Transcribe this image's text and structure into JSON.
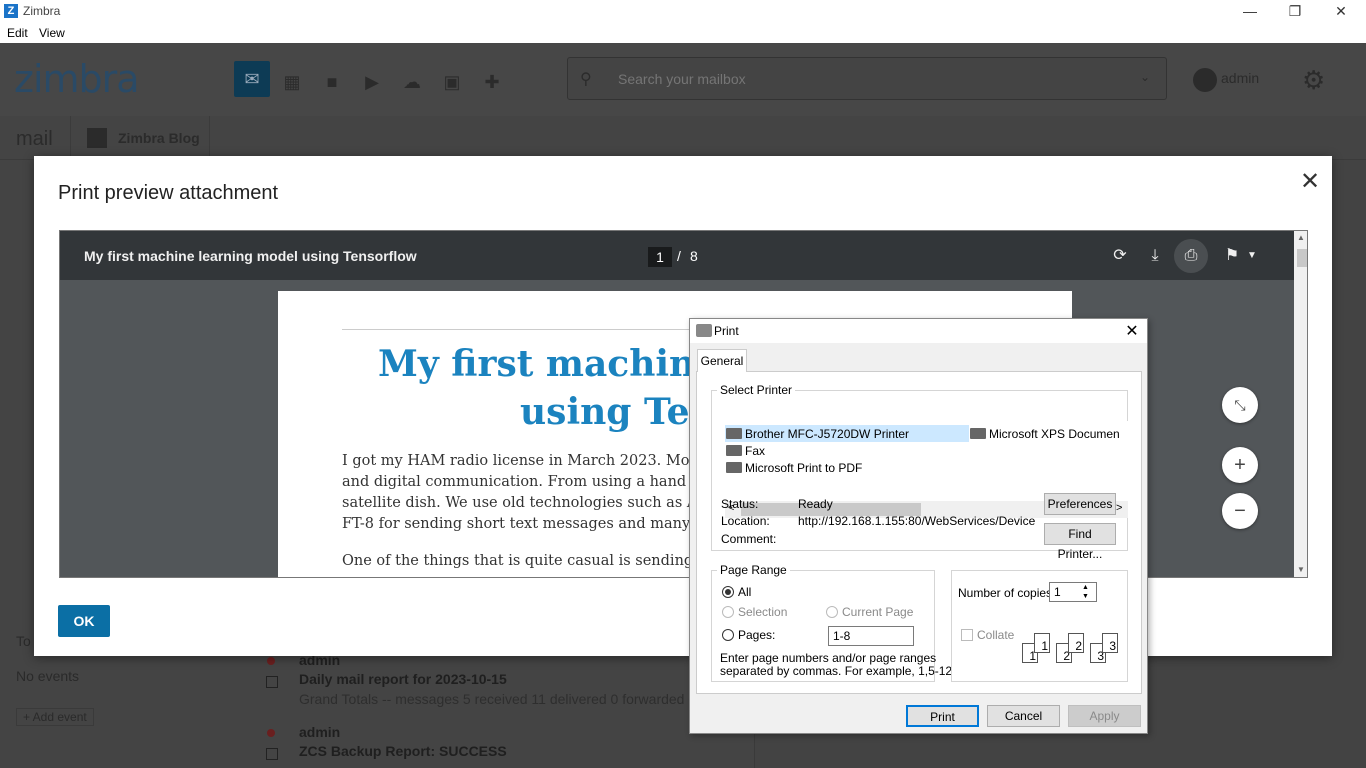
{
  "window": {
    "title": "Zimbra",
    "menu": [
      "Edit",
      "View"
    ],
    "controls": {
      "minimize": "—",
      "restore": "❐",
      "close": "✕"
    }
  },
  "app": {
    "logo": "zimbra",
    "search_placeholder": "Search your mailbox",
    "user": "admin",
    "tab_mail": "mail",
    "tab_blog": "Zimbra Blog",
    "calendar": {
      "partial": "To",
      "no_events": "No events",
      "add_event": "+ Add event"
    },
    "messages": [
      {
        "from": "admin",
        "subject": "Daily mail report for 2023-10-15",
        "snippet": "Grand Totals -- messages 5 received 11 delivered 0 forwarded 0"
      },
      {
        "from": "admin",
        "subject": "ZCS Backup Report: SUCCESS",
        "snippet": ""
      }
    ]
  },
  "modal": {
    "title": "Print preview attachment",
    "ok_label": "OK",
    "viewer": {
      "doc_title": "My first machine learning model using Tensorflow",
      "page_current": "1",
      "page_sep": "/",
      "page_total": "8",
      "pdf_heading_1": "My first machine",
      "pdf_heading_2": "using Ten",
      "pdf_lines": [
        "I got my HAM radio license in March 2023. Modern H",
        "and digital communication. From using a hand held",
        "satellite dish. We use old technologies such as AM to",
        "FT-8 for sending short text messages and many more"
      ],
      "pdf_para2": "One of the things that is quite casual is sending and"
    }
  },
  "print_dialog": {
    "title": "Print",
    "tab": "General",
    "select_printer_label": "Select Printer",
    "printers": [
      "Brother MFC-J5720DW Printer",
      "Fax",
      "Microsoft Print to PDF",
      "Microsoft XPS Documen"
    ],
    "status_label": "Status:",
    "status_value": "Ready",
    "location_label": "Location:",
    "location_value": "http://192.168.1.155:80/WebServices/Device",
    "comment_label": "Comment:",
    "preferences_btn": "Preferences",
    "find_printer_btn": "Find Printer...",
    "page_range_label": "Page Range",
    "range_all": "All",
    "range_selection": "Selection",
    "range_current": "Current Page",
    "range_pages": "Pages:",
    "pages_value": "1-8",
    "help_text_1": "Enter page numbers and/or page ranges",
    "help_text_2": "separated by commas.  For example, 1,5-12",
    "copies_label": "Number of copies:",
    "copies_value": "1",
    "collate_label": "Collate",
    "print_btn": "Print",
    "cancel_btn": "Cancel",
    "apply_btn": "Apply"
  },
  "colors": {
    "accent": "#0b6fa5",
    "heading": "#1b83bf",
    "selection": "#cce8ff"
  }
}
